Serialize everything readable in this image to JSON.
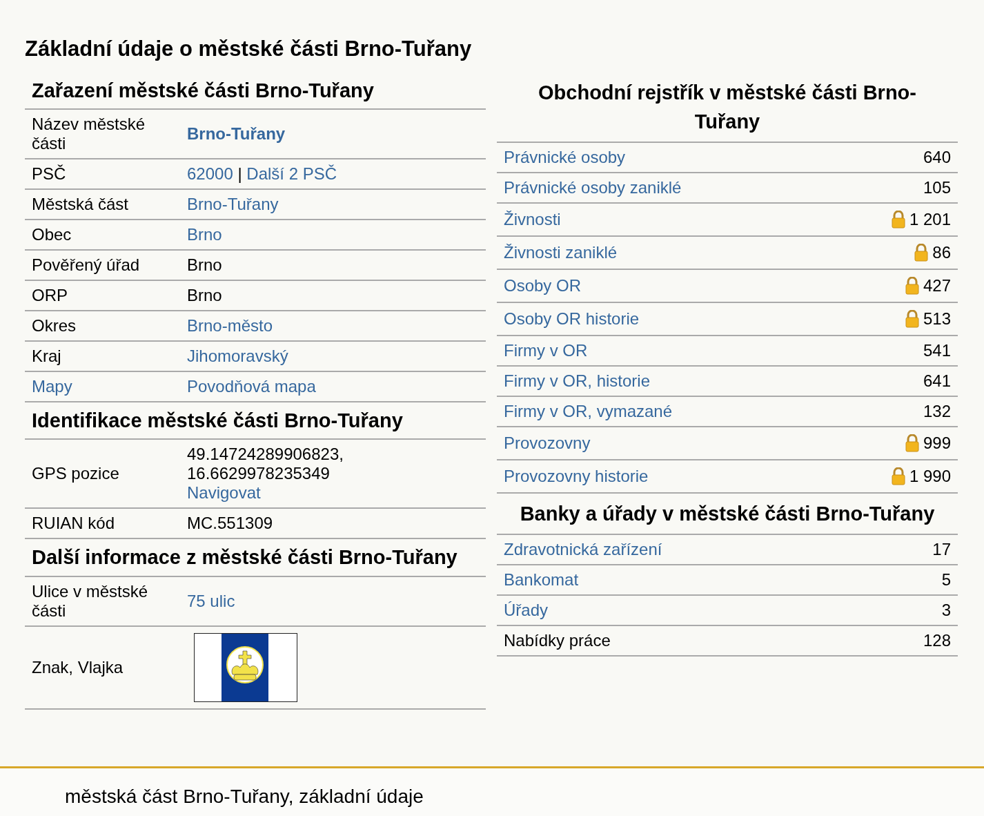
{
  "title": "Základní údaje o městské části Brno-Tuřany",
  "left_sections": [
    {
      "heading": "Zařazení městské části Brno-Tuřany",
      "rows": [
        {
          "kind": "text",
          "label": "Název městské části",
          "label_link": false,
          "bold": true,
          "lines": [
            [
              {
                "text": "Brno-Tuřany",
                "link": true
              }
            ]
          ]
        },
        {
          "kind": "text",
          "label": "PSČ",
          "label_link": false,
          "bold": false,
          "lines": [
            [
              {
                "text": "62000",
                "link": true
              },
              {
                "text": " | ",
                "link": false
              },
              {
                "text": "Další 2 PSČ",
                "link": true
              }
            ]
          ]
        },
        {
          "kind": "text",
          "label": "Městská část",
          "label_link": false,
          "bold": false,
          "lines": [
            [
              {
                "text": "Brno-Tuřany",
                "link": true
              }
            ]
          ]
        },
        {
          "kind": "text",
          "label": "Obec",
          "label_link": false,
          "bold": false,
          "lines": [
            [
              {
                "text": "Brno",
                "link": true
              }
            ]
          ]
        },
        {
          "kind": "text",
          "label": "Pověřený úřad",
          "label_link": false,
          "bold": false,
          "lines": [
            [
              {
                "text": "Brno",
                "link": false
              }
            ]
          ]
        },
        {
          "kind": "text",
          "label": "ORP",
          "label_link": false,
          "bold": false,
          "lines": [
            [
              {
                "text": "Brno",
                "link": false
              }
            ]
          ]
        },
        {
          "kind": "text",
          "label": "Okres",
          "label_link": false,
          "bold": false,
          "lines": [
            [
              {
                "text": "Brno-město",
                "link": true
              }
            ]
          ]
        },
        {
          "kind": "text",
          "label": "Kraj",
          "label_link": false,
          "bold": false,
          "lines": [
            [
              {
                "text": "Jihomoravský",
                "link": true
              }
            ]
          ]
        },
        {
          "kind": "text",
          "label": "Mapy",
          "label_link": true,
          "bold": false,
          "lines": [
            [
              {
                "text": "Povodňová mapa",
                "link": true
              }
            ]
          ]
        }
      ]
    },
    {
      "heading": "Identifikace městské části Brno-Tuřany",
      "rows": [
        {
          "kind": "text",
          "label": "GPS pozice",
          "label_link": false,
          "bold": false,
          "lines": [
            [
              {
                "text": "49.14724289906823,",
                "link": false
              }
            ],
            [
              {
                "text": "16.6629978235349",
                "link": false
              }
            ],
            [
              {
                "text": "Navigovat",
                "link": true
              }
            ]
          ]
        },
        {
          "kind": "text",
          "label": "RUIAN kód",
          "label_link": false,
          "bold": false,
          "lines": [
            [
              {
                "text": "MC.551309",
                "link": false
              }
            ]
          ]
        }
      ]
    },
    {
      "heading": "Další informace z městské části Brno-Tuřany",
      "rows": [
        {
          "kind": "text",
          "label": "Ulice v městské části",
          "label_link": false,
          "bold": false,
          "lines": [
            [
              {
                "text": "75 ulic",
                "link": true
              }
            ]
          ]
        },
        {
          "kind": "flag",
          "label": "Znak, Vlajka",
          "label_link": false
        }
      ]
    }
  ],
  "right_sections": [
    {
      "heading": "Obchodní rejstřík v městské části Brno-Tuřany",
      "rows": [
        {
          "label": "Právnické osoby",
          "link": true,
          "locked": false,
          "value": "640"
        },
        {
          "label": "Právnické osoby zaniklé",
          "link": true,
          "locked": false,
          "value": "105"
        },
        {
          "label": "Živnosti",
          "link": true,
          "locked": true,
          "value": "1 201"
        },
        {
          "label": "Živnosti zaniklé",
          "link": true,
          "locked": true,
          "value": "86"
        },
        {
          "label": "Osoby OR",
          "link": true,
          "locked": true,
          "value": "427"
        },
        {
          "label": "Osoby OR historie",
          "link": true,
          "locked": true,
          "value": "513"
        },
        {
          "label": "Firmy v OR",
          "link": true,
          "locked": false,
          "value": "541"
        },
        {
          "label": "Firmy v OR, historie",
          "link": true,
          "locked": false,
          "value": "641"
        },
        {
          "label": "Firmy v OR, vymazané",
          "link": true,
          "locked": false,
          "value": "132"
        },
        {
          "label": "Provozovny",
          "link": true,
          "locked": true,
          "value": "999"
        },
        {
          "label": "Provozovny historie",
          "link": true,
          "locked": true,
          "value": "1 990"
        }
      ]
    },
    {
      "heading": "Banky a úřady v městské části Brno-Tuřany",
      "rows": [
        {
          "label": "Zdravotnická zařízení",
          "link": true,
          "locked": false,
          "value": "17"
        },
        {
          "label": "Bankomat",
          "link": true,
          "locked": false,
          "value": "5"
        },
        {
          "label": "Úřady",
          "link": true,
          "locked": false,
          "value": "3"
        },
        {
          "label": "Nabídky práce",
          "link": false,
          "locked": false,
          "value": "128"
        }
      ]
    }
  ],
  "footer": "městská část Brno-Tuřany, základní údaje"
}
